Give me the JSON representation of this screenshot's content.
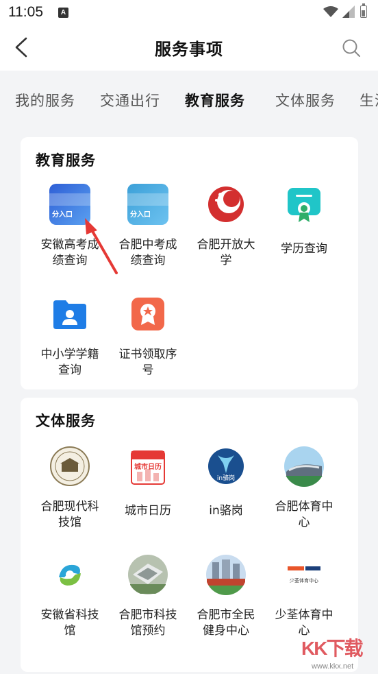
{
  "status_bar": {
    "time": "11:05",
    "app_badge": "A"
  },
  "nav": {
    "title": "服务事项",
    "back_icon": "chevron-left-icon",
    "search_icon": "search-icon"
  },
  "tabs": [
    {
      "label": "我的服务",
      "active": false
    },
    {
      "label": "交通出行",
      "active": false
    },
    {
      "label": "教育服务",
      "active": true
    },
    {
      "label": "文体服务",
      "active": false
    },
    {
      "label": "生活",
      "active": false
    }
  ],
  "education": {
    "title": "教育服务",
    "items": [
      {
        "label": "安徽高考成绩查询",
        "icon": "gaokao-banner-icon",
        "banner_text": "分入口"
      },
      {
        "label": "合肥中考成绩查询",
        "icon": "zhongkao-banner-icon",
        "banner_text": "分入口"
      },
      {
        "label": "合肥开放大学",
        "icon": "open-university-logo-icon"
      },
      {
        "label": "学历查询",
        "icon": "certificate-icon"
      },
      {
        "label": "中小学学籍查询",
        "icon": "student-folder-icon"
      },
      {
        "label": "证书领取序号",
        "icon": "award-icon"
      }
    ]
  },
  "culture": {
    "title": "文体服务",
    "items": [
      {
        "label": "合肥现代科技馆",
        "icon": "science-museum-seal-icon"
      },
      {
        "label": "城市日历",
        "icon": "calendar-icon",
        "icon_text": "城市日历"
      },
      {
        "label": "in骆岗",
        "icon": "luogang-logo-icon",
        "icon_text": "in骆岗"
      },
      {
        "label": "合肥体育中心",
        "icon": "stadium-photo-icon"
      },
      {
        "label": "安徽省科技馆",
        "icon": "anhui-science-logo-icon"
      },
      {
        "label": "合肥市科技馆预约",
        "icon": "museum-aerial-icon"
      },
      {
        "label": "合肥市全民健身中心",
        "icon": "fitness-center-photo-icon"
      },
      {
        "label": "少荃体育中心",
        "icon": "shaoquan-logo-icon",
        "icon_text": "少荃体育中心"
      }
    ]
  },
  "watermark": {
    "text": "KK下载",
    "url": "www.kkx.net"
  },
  "colors": {
    "accent_red": "#e53935",
    "page_bg": "#f3f4f6"
  }
}
